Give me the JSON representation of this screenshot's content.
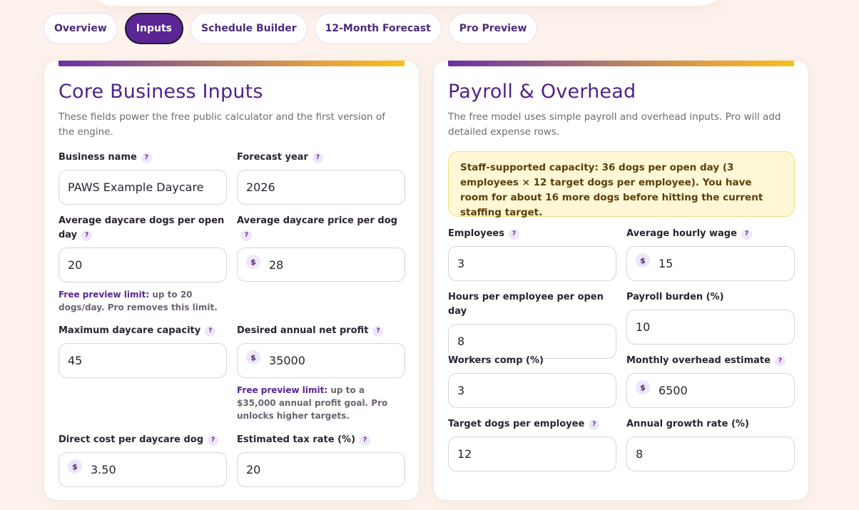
{
  "tabs": [
    {
      "label": "Overview",
      "active": false
    },
    {
      "label": "Inputs",
      "active": true
    },
    {
      "label": "Schedule Builder",
      "active": false
    },
    {
      "label": "12-Month Forecast",
      "active": false
    },
    {
      "label": "Pro Preview",
      "active": false
    }
  ],
  "core": {
    "title": "Core Business Inputs",
    "description": "These fields power the free public calculator and the first version of the engine.",
    "business_name": {
      "label": "Business name",
      "value": "PAWS Example Daycare"
    },
    "forecast_year": {
      "label": "Forecast year",
      "value": "2026"
    },
    "avg_dogs": {
      "label": "Average daycare dogs per open day",
      "value": "20"
    },
    "avg_price": {
      "label": "Average daycare price per dog",
      "value": "28"
    },
    "dogs_note": {
      "limit": "Free preview limit:",
      "text": " up to 20 dogs/day. Pro removes this limit."
    },
    "max_capacity": {
      "label": "Maximum daycare capacity",
      "value": "45"
    },
    "desired_profit": {
      "label": "Desired annual net profit",
      "value": "35000"
    },
    "profit_note": {
      "limit": "Free preview limit:",
      "text": " up to a $35,000 annual profit goal. Pro unlocks higher targets."
    },
    "direct_cost": {
      "label": "Direct cost per daycare dog",
      "value": "3.50"
    },
    "tax_rate": {
      "label": "Estimated tax rate (%)",
      "value": "20"
    }
  },
  "payroll": {
    "title": "Payroll & Overhead",
    "description": "The free model uses simple payroll and overhead inputs. Pro will add detailed expense rows.",
    "alert": "Staff-supported capacity: 36 dogs per open day (3 employees × 12 target dogs per employee). You have room for about 16 more dogs before hitting the current staffing target.",
    "employees": {
      "label": "Employees",
      "value": "3"
    },
    "hourly_wage": {
      "label": "Average hourly wage",
      "value": "15"
    },
    "hours_per_employee": {
      "label": "Hours per employee per open day",
      "value": "8"
    },
    "payroll_burden": {
      "label": "Payroll burden (%)",
      "value": "10"
    },
    "workers_comp": {
      "label": "Workers comp (%)",
      "value": "3"
    },
    "monthly_overhead": {
      "label": "Monthly overhead estimate",
      "value": "6500"
    },
    "target_dogs": {
      "label": "Target dogs per employee",
      "value": "12"
    },
    "growth_rate": {
      "label": "Annual growth rate (%)",
      "value": "8"
    }
  },
  "icons": {
    "help": "?",
    "dollar": "$"
  },
  "colors": {
    "accent": "#5b2593",
    "title": "#4e2486",
    "alert_bg": "#fff7d6"
  }
}
